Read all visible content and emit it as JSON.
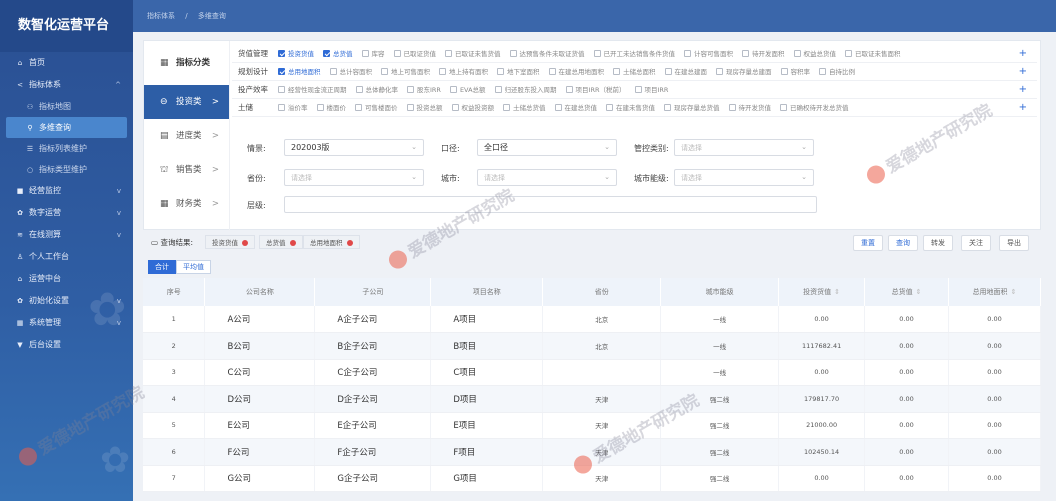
{
  "app": {
    "title": "数智化运营平台"
  },
  "sidebar": {
    "items": [
      {
        "label": "首页",
        "icon": "home-icon",
        "glyph": "⌂"
      },
      {
        "label": "指标体系",
        "icon": "share-icon",
        "glyph": "<",
        "arrow": "^"
      },
      {
        "label": "指标地图",
        "icon": "user-icon",
        "glyph": "⚇",
        "sub": true
      },
      {
        "label": "多维查询",
        "icon": "search-icon",
        "glyph": "⚲",
        "sub": true,
        "active": true
      },
      {
        "label": "指标列表维护",
        "icon": "list-icon",
        "glyph": "☰",
        "sub": true
      },
      {
        "label": "指标类型维护",
        "icon": "circle-icon",
        "glyph": "○",
        "sub": true
      },
      {
        "label": "经营监控",
        "icon": "square-icon",
        "glyph": "■",
        "arrow": "v"
      },
      {
        "label": "数字运营",
        "icon": "gear-icon",
        "glyph": "✿",
        "arrow": "v"
      },
      {
        "label": "在线测算",
        "icon": "calc-icon",
        "glyph": "≋",
        "arrow": "v"
      },
      {
        "label": "个人工作台",
        "icon": "person-icon",
        "glyph": "♙"
      },
      {
        "label": "运营中台",
        "icon": "home-icon",
        "glyph": "⌂"
      },
      {
        "label": "初始化设置",
        "icon": "settings-icon",
        "glyph": "✿",
        "arrow": "v"
      },
      {
        "label": "系统管理",
        "icon": "grid-icon",
        "glyph": "▦",
        "arrow": "v"
      },
      {
        "label": "后台设置",
        "icon": "pin-icon",
        "glyph": "▼"
      }
    ]
  },
  "breadcrumb": [
    "指标体系",
    "多维查询"
  ],
  "categories": [
    {
      "label": "指标分类",
      "icon": "grid-icon",
      "glyph": "▦"
    },
    {
      "label": "投资类",
      "icon": "invest-icon",
      "glyph": "⊖",
      "arrow": ">",
      "active": true
    },
    {
      "label": "进度类",
      "icon": "doc-icon",
      "glyph": "▤",
      "arrow": ">"
    },
    {
      "label": "销售类",
      "icon": "cart-icon",
      "glyph": "⛫",
      "arrow": ">"
    },
    {
      "label": "财务类",
      "icon": "calendar-icon",
      "glyph": "▦",
      "arrow": ">"
    }
  ],
  "checkRows": [
    {
      "label": "货值管理",
      "items": [
        {
          "t": "投资货值",
          "on": true
        },
        {
          "t": "总货值",
          "on": true
        },
        {
          "t": "库容"
        },
        {
          "t": "已取证货值"
        },
        {
          "t": "已取证未售货值"
        },
        {
          "t": "达预售条件未取证货值"
        },
        {
          "t": "已开工未达销售条件货值"
        },
        {
          "t": "计容可售面积"
        },
        {
          "t": "待开发面积"
        },
        {
          "t": "权益总货值"
        },
        {
          "t": "已取证未售面积"
        }
      ]
    },
    {
      "label": "规划设计",
      "items": [
        {
          "t": "总用地面积",
          "on": true
        },
        {
          "t": "总计容面积"
        },
        {
          "t": "地上可售面积"
        },
        {
          "t": "地上持有面积"
        },
        {
          "t": "地下室面积"
        },
        {
          "t": "在建总用地面积"
        },
        {
          "t": "土储总面积"
        },
        {
          "t": "在建总建面"
        },
        {
          "t": "现房存量总建面"
        },
        {
          "t": "容积率"
        },
        {
          "t": "自持比例"
        }
      ]
    },
    {
      "label": "投产效率",
      "items": [
        {
          "t": "经营性现金流正周期"
        },
        {
          "t": "总体静化率"
        },
        {
          "t": "股东IRR"
        },
        {
          "t": "EVA总额"
        },
        {
          "t": "归还股东投入周期"
        },
        {
          "t": "项目IRR（税前）"
        },
        {
          "t": "项目IRR"
        }
      ]
    },
    {
      "label": "土储",
      "items": [
        {
          "t": "溢价率"
        },
        {
          "t": "楼面价"
        },
        {
          "t": "可售楼面价"
        },
        {
          "t": "投资总额"
        },
        {
          "t": "权益投资额"
        },
        {
          "t": "土储总货值"
        },
        {
          "t": "在建总货值"
        },
        {
          "t": "在建未售货值"
        },
        {
          "t": "现房存量总货值"
        },
        {
          "t": "待开发货值"
        },
        {
          "t": "已确权待开发总货值"
        }
      ]
    }
  ],
  "form": {
    "version": {
      "label": "情景:",
      "value": "202003版"
    },
    "caliber": {
      "label": "口径:",
      "value": "全口径"
    },
    "mgmt": {
      "label": "管控类别:",
      "placeholder": "请选择"
    },
    "province": {
      "label": "省份:",
      "placeholder": "请选择"
    },
    "city": {
      "label": "城市:",
      "placeholder": "请选择"
    },
    "citylevel": {
      "label": "城市能级:",
      "placeholder": "请选择"
    },
    "level": {
      "label": "层级:"
    }
  },
  "result": {
    "label": "查询结果:",
    "tags": [
      "投资货值",
      "总货值",
      "总用地面积"
    ]
  },
  "actions": [
    "重置",
    "查询",
    "转发",
    "关注",
    "导出"
  ],
  "tabs": [
    "合计",
    "平均值"
  ],
  "table": {
    "headers": [
      "序号",
      "公司名称",
      "子公司",
      "项目名称",
      "省份",
      "城市能级",
      "投资货值",
      "总货值",
      "总用地面积"
    ],
    "sortable": [
      6,
      7,
      8
    ],
    "rows": [
      [
        "1",
        "A公司",
        "A企子公司",
        "A项目",
        "北京",
        "一线",
        "0.00",
        "0.00",
        "0.00"
      ],
      [
        "2",
        "B公司",
        "B企子公司",
        "B项目",
        "北京",
        "一线",
        "1117682.41",
        "0.00",
        "0.00"
      ],
      [
        "3",
        "C公司",
        "C企子公司",
        "C项目",
        "",
        "一线",
        "0.00",
        "0.00",
        "0.00"
      ],
      [
        "4",
        "D公司",
        "D企子公司",
        "D项目",
        "天津",
        "强二线",
        "179817.70",
        "0.00",
        "0.00"
      ],
      [
        "5",
        "E公司",
        "E企子公司",
        "E项目",
        "天津",
        "强二线",
        "21000.00",
        "0.00",
        "0.00"
      ],
      [
        "6",
        "F公司",
        "F企子公司",
        "F项目",
        "天津",
        "强二线",
        "102450.14",
        "0.00",
        "0.00"
      ],
      [
        "7",
        "G公司",
        "G企子公司",
        "G项目",
        "天津",
        "强二线",
        "0.00",
        "0.00",
        "0.00"
      ]
    ]
  },
  "watermark": "爱德地产研究院",
  "colors": {
    "sidebar": "#2f5ea4",
    "accent": "#2f6bd6",
    "activeCat": "#2d5ea6",
    "tagClose": "#e04848"
  }
}
